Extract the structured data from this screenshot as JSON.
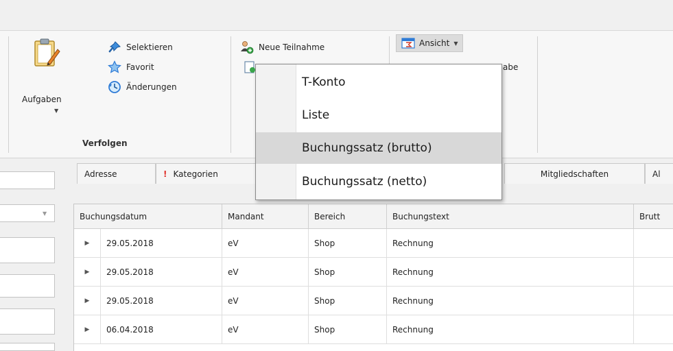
{
  "ribbon": {
    "aufgaben_label": "Aufgaben",
    "selektieren_label": "Selektieren",
    "favorit_label": "Favorit",
    "aenderungen_label": "Änderungen",
    "verfolgen_group_label": "Verfolgen",
    "neue_teilnahme_label": "Neue Teilnahme",
    "ansicht_label": "Ansicht",
    "hidden_partial_label": "abe"
  },
  "menu": {
    "items": [
      {
        "label": "T-Konto"
      },
      {
        "label": "Liste"
      },
      {
        "label": "Buchungssatz (brutto)"
      },
      {
        "label": "Buchungssatz (netto)"
      }
    ],
    "hovered_index": 2
  },
  "tabs": [
    {
      "label": "Adresse"
    },
    {
      "label": "Kategorien"
    },
    {
      "label": "Mitgliedschaften"
    },
    {
      "label": "Al"
    }
  ],
  "grid": {
    "columns": [
      "Buchungsdatum",
      "Mandant",
      "Bereich",
      "Buchungstext",
      "Brutt"
    ],
    "rows": [
      {
        "datum": "29.05.2018",
        "mandant": "eV",
        "bereich": "Shop",
        "text": "Rechnung"
      },
      {
        "datum": "29.05.2018",
        "mandant": "eV",
        "bereich": "Shop",
        "text": "Rechnung"
      },
      {
        "datum": "29.05.2018",
        "mandant": "eV",
        "bereich": "Shop",
        "text": "Rechnung"
      },
      {
        "datum": "06.04.2018",
        "mandant": "eV",
        "bereich": "Shop",
        "text": "Rechnung"
      }
    ]
  },
  "colors": {
    "accent_blue": "#2e7bd6",
    "warning_red": "#e0312b",
    "menu_hover": "#d8d8d8"
  }
}
